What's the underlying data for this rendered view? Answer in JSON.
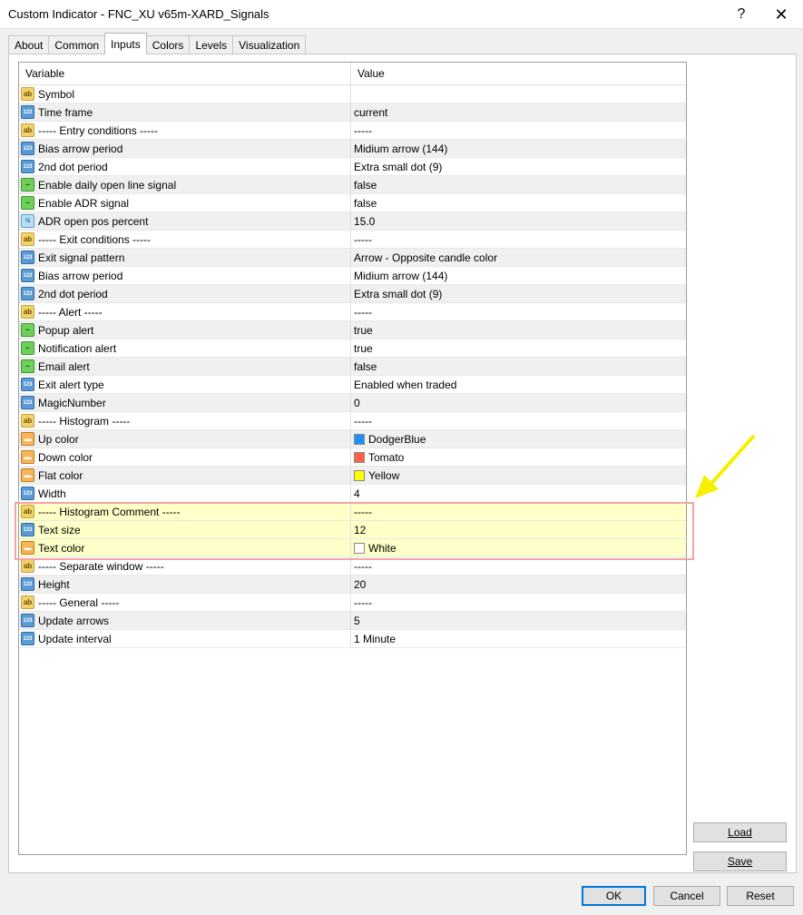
{
  "window": {
    "title": "Custom Indicator - FNC_XU v65m-XARD_Signals",
    "help_label": "?",
    "close_label": "✕"
  },
  "tabs": [
    {
      "label": "About"
    },
    {
      "label": "Common"
    },
    {
      "label": "Inputs"
    },
    {
      "label": "Colors"
    },
    {
      "label": "Levels"
    },
    {
      "label": "Visualization"
    }
  ],
  "active_tab": "Inputs",
  "grid": {
    "columns": {
      "variable": "Variable",
      "value": "Value"
    },
    "rows": [
      {
        "icon": "ab",
        "name": "Symbol",
        "value": ""
      },
      {
        "icon": "123",
        "name": "Time frame",
        "value": "current"
      },
      {
        "icon": "ab",
        "name": "----- Entry conditions -----",
        "value": "-----"
      },
      {
        "icon": "123",
        "name": "Bias arrow period",
        "value": "Midium arrow (144)"
      },
      {
        "icon": "123",
        "name": "2nd dot period",
        "value": "Extra small dot (9)"
      },
      {
        "icon": "bool",
        "name": "Enable daily open line signal",
        "value": "false"
      },
      {
        "icon": "bool",
        "name": "Enable ADR signal",
        "value": "false"
      },
      {
        "icon": "dbl",
        "name": "ADR open pos percent",
        "value": "15.0"
      },
      {
        "icon": "ab",
        "name": "----- Exit conditions -----",
        "value": "-----"
      },
      {
        "icon": "123",
        "name": "Exit signal pattern",
        "value": "Arrow - Opposite candle color"
      },
      {
        "icon": "123",
        "name": "Bias arrow period",
        "value": "Midium arrow (144)"
      },
      {
        "icon": "123",
        "name": "2nd dot period",
        "value": "Extra small dot (9)"
      },
      {
        "icon": "ab",
        "name": "----- Alert -----",
        "value": "-----"
      },
      {
        "icon": "bool",
        "name": "Popup alert",
        "value": "true"
      },
      {
        "icon": "bool",
        "name": "Notification alert",
        "value": "true"
      },
      {
        "icon": "bool",
        "name": "Email alert",
        "value": "false"
      },
      {
        "icon": "123",
        "name": "Exit alert type",
        "value": "Enabled when traded"
      },
      {
        "icon": "123",
        "name": "MagicNumber",
        "value": "0"
      },
      {
        "icon": "ab",
        "name": "----- Histogram -----",
        "value": "-----"
      },
      {
        "icon": "color",
        "name": "Up color",
        "value": "DodgerBlue",
        "swatch": "#1e90ff"
      },
      {
        "icon": "color",
        "name": "Down color",
        "value": "Tomato",
        "swatch": "#ff6347"
      },
      {
        "icon": "color",
        "name": "Flat color",
        "value": "Yellow",
        "swatch": "#ffff00"
      },
      {
        "icon": "123",
        "name": "Width",
        "value": "4"
      },
      {
        "icon": "ab",
        "name": "----- Histogram Comment -----",
        "value": "-----",
        "highlight": true
      },
      {
        "icon": "123",
        "name": "Text size",
        "value": "12",
        "highlight": true
      },
      {
        "icon": "color",
        "name": "Text color",
        "value": "White",
        "swatch": "#ffffff",
        "highlight": true
      },
      {
        "icon": "ab",
        "name": "----- Separate window -----",
        "value": "-----"
      },
      {
        "icon": "123",
        "name": "Height",
        "value": "20"
      },
      {
        "icon": "ab",
        "name": "----- General -----",
        "value": "-----"
      },
      {
        "icon": "123",
        "name": "Update arrows",
        "value": "5"
      },
      {
        "icon": "123",
        "name": "Update interval",
        "value": "1 Minute"
      }
    ]
  },
  "buttons": {
    "load": "Load",
    "save": "Save",
    "ok": "OK",
    "cancel": "Cancel",
    "reset": "Reset"
  },
  "colors": {
    "highlight_row": "#ffffc8",
    "highlight_border": "#f4a4a4",
    "arrow": "#f5f000"
  }
}
